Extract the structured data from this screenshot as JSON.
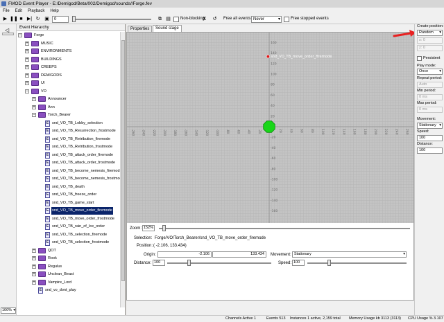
{
  "window": {
    "title": "FMOD Event Player - E:/Demigod/Beta/002/Demigod/sounds//Forge.fev"
  },
  "menu": [
    "File",
    "Edit",
    "Playback",
    "Help"
  ],
  "toolbar": {
    "counter_value": "0",
    "non_blocking_label": "Non-blocking",
    "x_label": "X",
    "free_all_events_label": "Free all events:",
    "free_all_events_value": "Never",
    "free_stopped_events_label": "Free stopped events"
  },
  "left_strip": {
    "zoom_value": "100%"
  },
  "event_hierarchy": {
    "header": "Event Hierarchy",
    "items": [
      {
        "label": "Forge",
        "type": "folder",
        "depth": 0,
        "expanded": true
      },
      {
        "label": "MUSIC",
        "type": "folder",
        "depth": 1,
        "expanded": false
      },
      {
        "label": "ENVIRONMENTS",
        "type": "folder",
        "depth": 1,
        "expanded": false
      },
      {
        "label": "BUILDINGS",
        "type": "folder",
        "depth": 1,
        "expanded": false
      },
      {
        "label": "CREEPS",
        "type": "folder",
        "depth": 1,
        "expanded": false
      },
      {
        "label": "DEMIGODS",
        "type": "folder",
        "depth": 1,
        "expanded": false
      },
      {
        "label": "UI",
        "type": "folder",
        "depth": 1,
        "expanded": false
      },
      {
        "label": "VO",
        "type": "folder",
        "depth": 1,
        "expanded": true
      },
      {
        "label": "Announcer",
        "type": "folder",
        "depth": 2,
        "expanded": false
      },
      {
        "label": "Ann",
        "type": "folder",
        "depth": 2,
        "expanded": false
      },
      {
        "label": "Torch_Bearer",
        "type": "folder",
        "depth": 2,
        "expanded": true
      },
      {
        "label": "snd_VO_TB_Lobby_selection",
        "type": "event",
        "depth": 3
      },
      {
        "label": "snd_VO_TB_Resurrection_frostmode",
        "type": "event",
        "depth": 3
      },
      {
        "label": "snd_VO_TB_Retribution_firemode",
        "type": "event",
        "depth": 3
      },
      {
        "label": "snd_VO_TB_Retribution_frostmode",
        "type": "event",
        "depth": 3
      },
      {
        "label": "snd_VO_TB_attack_order_firemode",
        "type": "event",
        "depth": 3
      },
      {
        "label": "snd_VO_TB_attack_order_frostmode",
        "type": "event",
        "depth": 3
      },
      {
        "label": "snd_VO_TB_become_nemesis_firemod",
        "type": "event",
        "depth": 3
      },
      {
        "label": "snd_VO_TB_become_nemesis_frostmode",
        "type": "event",
        "depth": 3
      },
      {
        "label": "snd_VO_TB_death",
        "type": "event",
        "depth": 3
      },
      {
        "label": "snd_VO_TB_freeze_order",
        "type": "event",
        "depth": 3
      },
      {
        "label": "snd_VO_TB_game_start",
        "type": "event",
        "depth": 3
      },
      {
        "label": "snd_VO_TB_move_order_firemode",
        "type": "event",
        "depth": 3,
        "selected": true
      },
      {
        "label": "snd_VO_TB_move_order_frostmode",
        "type": "event",
        "depth": 3
      },
      {
        "label": "snd_VO_TB_rain_of_Ice_order",
        "type": "event",
        "depth": 3
      },
      {
        "label": "snd_VO_TB_selection_firemode",
        "type": "event",
        "depth": 3
      },
      {
        "label": "snd_VO_TB_selection_frostmode",
        "type": "event",
        "depth": 3
      },
      {
        "label": "QOT",
        "type": "folder",
        "depth": 2,
        "expanded": false
      },
      {
        "label": "Rook",
        "type": "folder",
        "depth": 2,
        "expanded": false
      },
      {
        "label": "Regulus",
        "type": "folder",
        "depth": 2,
        "expanded": false
      },
      {
        "label": "Unclean_Beast",
        "type": "folder",
        "depth": 2,
        "expanded": false
      },
      {
        "label": "Vampire_Lord",
        "type": "folder",
        "depth": 2,
        "expanded": false
      },
      {
        "label": "snd_vo_dont_play",
        "type": "event",
        "depth": 2
      }
    ]
  },
  "tabs": [
    "Properties",
    "Sound stage"
  ],
  "sound_stage": {
    "event_label": "snd_VO_TB_move_order_firemode",
    "x_ticks": [
      "-260",
      "-240",
      "-220",
      "-200",
      "-180",
      "-160",
      "-140",
      "-120",
      "-100",
      "-80",
      "-60",
      "-40",
      "-20",
      "0",
      "20",
      "40",
      "60",
      "80",
      "100",
      "120",
      "140",
      "160",
      "180",
      "200",
      "220",
      "240",
      "260"
    ],
    "y_ticks": [
      "160",
      "140",
      "120",
      "100",
      "80",
      "60",
      "40",
      "20",
      "0",
      "-20",
      "-40",
      "-60",
      "-80",
      "-100",
      "-120",
      "-140",
      "-160"
    ],
    "event_x": -2.106,
    "event_y": 133.434,
    "listener_x": 0,
    "listener_y": 0
  },
  "bottom": {
    "zoom_label": "Zoom:",
    "zoom_value": "152%",
    "selection_label": "Selection:",
    "selection_value": "Forge/VO/Torch_Bearer/snd_VO_TB_move_order_firemode",
    "position_label": "Position:",
    "position_value": "( -2.106, 133.434)",
    "origin_label": "Origin:",
    "origin_x": "-2.106",
    "origin_y": "133.434",
    "movement_label": "Movement:",
    "movement_value": "Stationary",
    "distance_label": "Distance:",
    "distance_value": "100",
    "speed_label": "Speed:",
    "speed_value": "100"
  },
  "right_panel": {
    "create_position_label": "Create position:",
    "create_position_value": "Random",
    "x_label": "x:",
    "x_value": "0",
    "z_label": "z:",
    "z_value": "0",
    "persistent_label": "Persistent",
    "play_mode_label": "Play mode:",
    "play_mode_value": "Once",
    "repeat_period_label": "Repeat period:",
    "repeat_period_value": "Auto",
    "min_period_label": "Min period:",
    "min_period_value": "0 ms",
    "max_period_label": "Max period:",
    "max_period_value": "0 ms",
    "movement_label": "Movement:",
    "movement_value": "Stationary",
    "speed_label": "Speed:",
    "speed_value": "100",
    "distance_label": "Distance:",
    "distance_value": "100"
  },
  "status": {
    "channels": "Channels Active   1",
    "events": "Events  513",
    "instances": "Instances  1 active, 2,159 total",
    "memory": "Memory Usage kb  3113 (3113)",
    "cpu": "CPU Usage %  3.107"
  },
  "colors": {
    "selection_bg": "#0a246a",
    "grid_bg": "#c4c4c4",
    "listener": "#18d618",
    "event_dot": "#e01818",
    "arrow": "#e82020"
  }
}
